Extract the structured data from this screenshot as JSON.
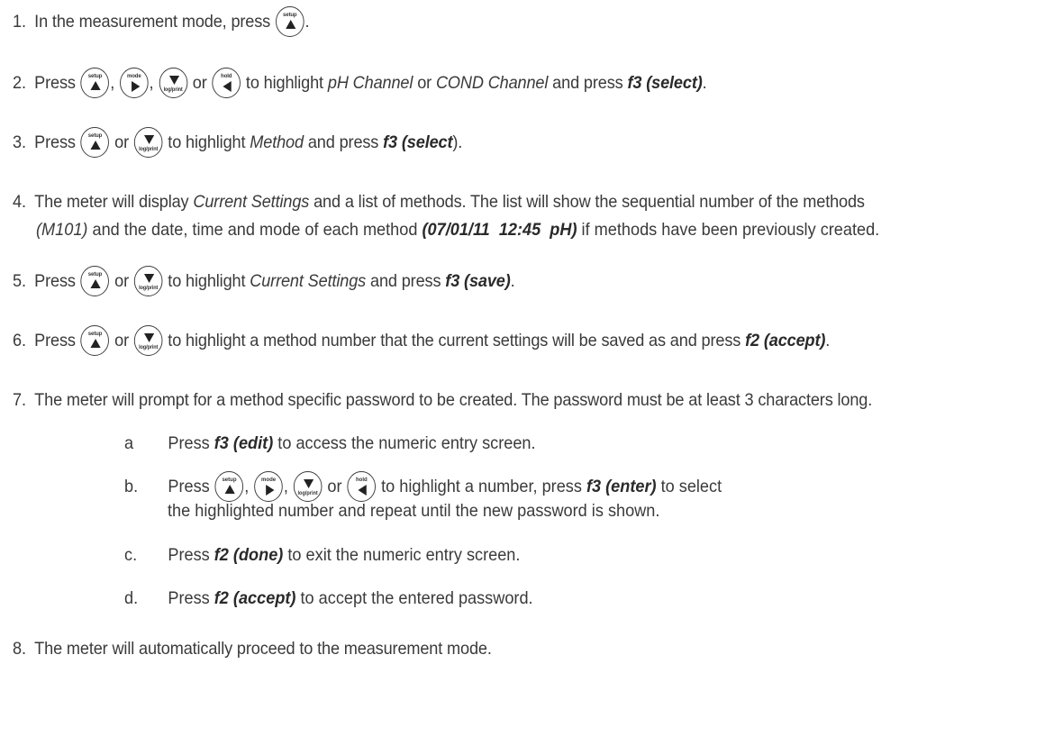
{
  "steps": {
    "s1": {
      "num": "1.",
      "a": "In the measurement mode, press",
      "b": "."
    },
    "s2": {
      "num": "2.",
      "a": "Press",
      "c1": ",",
      "c2": ",",
      "or": "or",
      "b": "to highlight",
      "pH": "pH Channel",
      "or2": "or",
      "cond": "COND Channel",
      "c": "and press",
      "f": "f3 (select)",
      "end": "."
    },
    "s3": {
      "num": "3.",
      "a": "Press",
      "or": "or",
      "b": "to highlight",
      "m": "Method",
      "c": "and press",
      "f": "f3 (select",
      "end": ")."
    },
    "s4": {
      "num": "4.",
      "a": "The meter will display",
      "cs": "Current Settings",
      "b": "and a list of methods. The list will show the sequential number of the methods",
      "m101": "(M101)",
      "c": "and the date, time and mode of each method",
      "dt": "(07/01/11  12:45  pH)",
      "d": "if methods have been previously created."
    },
    "s5": {
      "num": "5.",
      "a": "Press",
      "or": "or",
      "b": "to highlight",
      "cs": "Current Settings",
      "c": "and press",
      "f": "f3 (save)",
      "end": "."
    },
    "s6": {
      "num": "6.",
      "a": "Press",
      "or": "or",
      "b": "to highlight a method number that the current settings will be saved as and press",
      "f": "f2 (accept)",
      "end": "."
    },
    "s7": {
      "num": "7.",
      "a": "The meter will prompt for a method specific password to be created. The password must be at least 3 characters long."
    },
    "s8": {
      "num": "8.",
      "a": "The meter will automatically proceed to the measurement mode."
    }
  },
  "substeps": {
    "a": {
      "letter": "a",
      "p": "Press",
      "f": "f3 (edit)",
      "t": "to access the numeric entry screen."
    },
    "b": {
      "letter": "b.",
      "p": "Press",
      "c1": ",",
      "c2": ",",
      "or": "or",
      "t": "to highlight a number, press",
      "f": "f3 (enter)",
      "t2": "to select",
      "line2": "the highlighted number and repeat until the new password is shown."
    },
    "c": {
      "letter": "c.",
      "p": "Press",
      "f": "f2 (done)",
      "t": "to exit the numeric entry screen."
    },
    "d": {
      "letter": "d.",
      "p": "Press",
      "f": "f2 (accept)",
      "t": "to accept the entered password."
    }
  },
  "keys": {
    "setup": {
      "label": "setup",
      "icon": "up-arrow-icon"
    },
    "mode": {
      "label": "mode",
      "icon": "right-arrow-icon"
    },
    "log": {
      "label": "log/print",
      "icon": "down-arrow-icon"
    },
    "hold": {
      "label": "hold",
      "icon": "left-arrow-icon"
    }
  }
}
